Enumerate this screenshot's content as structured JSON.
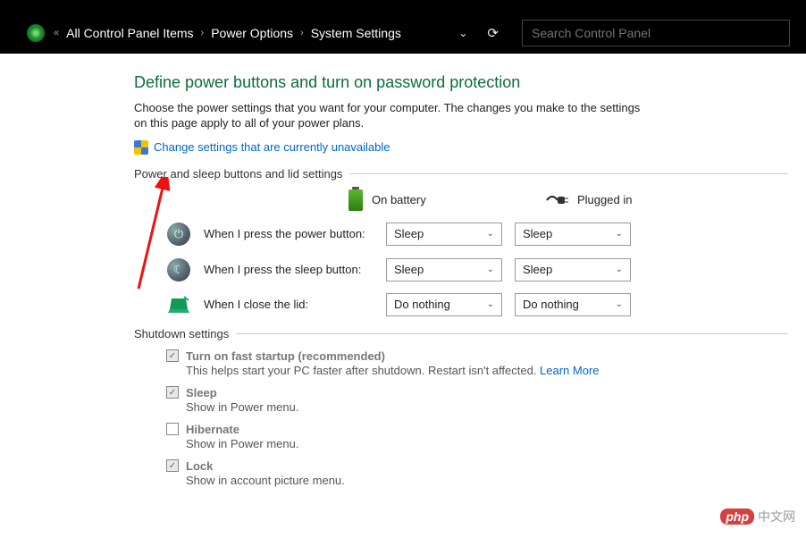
{
  "breadcrumb": {
    "prefix": "«",
    "item1": "All Control Panel Items",
    "item2": "Power Options",
    "item3": "System Settings"
  },
  "search": {
    "placeholder": "Search Control Panel"
  },
  "page": {
    "title": "Define power buttons and turn on password protection",
    "description": "Choose the power settings that you want for your computer. The changes you make to the settings on this page apply to all of your power plans.",
    "change_link": "Change settings that are currently unavailable"
  },
  "section_buttons": {
    "title": "Power and sleep buttons and lid settings",
    "col_battery": "On battery",
    "col_plugged": "Plugged in",
    "rows": [
      {
        "label": "When I press the power button:",
        "battery": "Sleep",
        "plugged": "Sleep"
      },
      {
        "label": "When I press the sleep button:",
        "battery": "Sleep",
        "plugged": "Sleep"
      },
      {
        "label": "When I close the lid:",
        "battery": "Do nothing",
        "plugged": "Do nothing"
      }
    ]
  },
  "section_shutdown": {
    "title": "Shutdown settings",
    "items": [
      {
        "label": "Turn on fast startup (recommended)",
        "desc": "This helps start your PC faster after shutdown. Restart isn't affected. ",
        "link": "Learn More",
        "checked": true
      },
      {
        "label": "Sleep",
        "desc": "Show in Power menu.",
        "checked": true
      },
      {
        "label": "Hibernate",
        "desc": "Show in Power menu.",
        "checked": false
      },
      {
        "label": "Lock",
        "desc": "Show in account picture menu.",
        "checked": true
      }
    ]
  },
  "watermark": {
    "badge": "php",
    "text": "中文网"
  }
}
